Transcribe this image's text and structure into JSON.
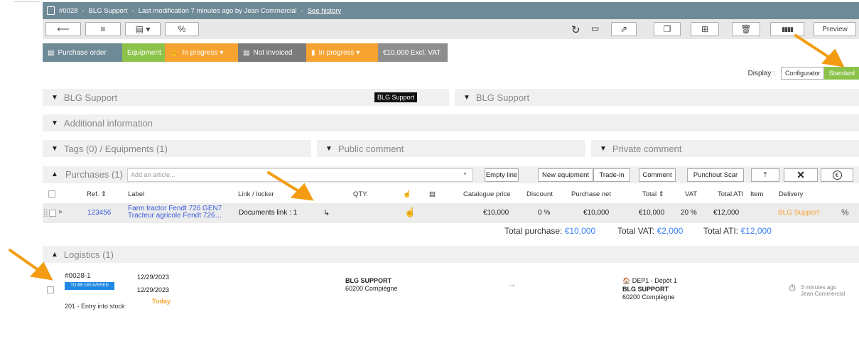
{
  "titlebar": {
    "id": "#0028",
    "sep1": "-",
    "name": "BLG Support",
    "sep2": "-",
    "modified": "Last modification 7 minutes ago by Jean Commercial",
    "sep3": "-",
    "history_link": "See history"
  },
  "toolbar": {
    "back_icon": "back-arrow-icon",
    "list_icon": "list-icon",
    "doc_icon": "document-icon",
    "percent_label": "%",
    "preview_label": "Preview"
  },
  "statusbar": [
    {
      "label": "Purchase order",
      "color": "#6f8a97"
    },
    {
      "label": "Equipment",
      "color": "#8bc34a"
    },
    {
      "label": "In progress ▾",
      "color": "#f7a331"
    },
    {
      "label": "Not invoiced",
      "color": "#7b7b7b"
    },
    {
      "label": "In progress ▾",
      "color": "#f7a331"
    },
    {
      "label": "€10,000 Excl. VAT",
      "color": "#8e8e8e"
    }
  ],
  "display": {
    "label": "Display :",
    "configurator": "Configurator",
    "standard": "Standard"
  },
  "panels": {
    "supplier_left": "BLG Support",
    "supplier_tag": "BLG Support",
    "supplier_right": "BLG Support",
    "additional": "Additional information",
    "tags": "Tags (0) / Equipments (1)",
    "public_comment": "Public comment",
    "private_comment": "Private comment"
  },
  "purchases": {
    "title": "Purchases (1)",
    "add_placeholder": "Add an article...",
    "buttons": {
      "empty_line": "Empty line",
      "new_equipment": "New equipment",
      "trade_in": "Trade-in",
      "comment": "Comment",
      "punchout": "Punchout Scar"
    },
    "columns": {
      "ref": "Ref. ⇕",
      "label": "Label",
      "link": "Link / locker",
      "qty": "QTY.",
      "catalogue": "Catalogue price",
      "discount": "Discount",
      "purchase_net": "Purchase net",
      "total": "Total ⇕",
      "vat": "VAT",
      "total_ati": "Total ATI",
      "item": "Item",
      "delivery": "Delivery"
    },
    "row": {
      "ref": "123456",
      "label1": "Farm tractor Fendt 726 GEN7",
      "label2": "Tracteur agricole Fendt 726…",
      "link": "Documents link : 1",
      "catalogue": "€10,000",
      "discount": "0 %",
      "purchase_net": "€10,000",
      "total": "€10,000",
      "vat": "20 %",
      "total_ati": "€12,000",
      "delivery": "BLG Support",
      "percent": "%"
    },
    "totals": {
      "purchase_label": "Total purchase:",
      "purchase_value": "€10,000",
      "vat_label": "Total VAT:",
      "vat_value": "€2,000",
      "ati_label": "Total ATI:",
      "ati_value": "€12,000"
    }
  },
  "logistics": {
    "title": "Logistics (1)",
    "item": {
      "id": "#0028-1",
      "badge": "TO BE DELIVERED",
      "entry": "201 - Entry into stock",
      "date1": "12/29/2023",
      "date2": "12/29/2023",
      "today": "Today",
      "from_name": "BLG SUPPORT",
      "from_city": "60200 Compiègne",
      "arrow": "→",
      "depot": "DEP1 - Dépôt 1",
      "to_name": "BLG SUPPORT",
      "to_city": "60200 Compiègne",
      "time_ago": "3 minutes ago",
      "user": "Jean Commercial"
    }
  }
}
